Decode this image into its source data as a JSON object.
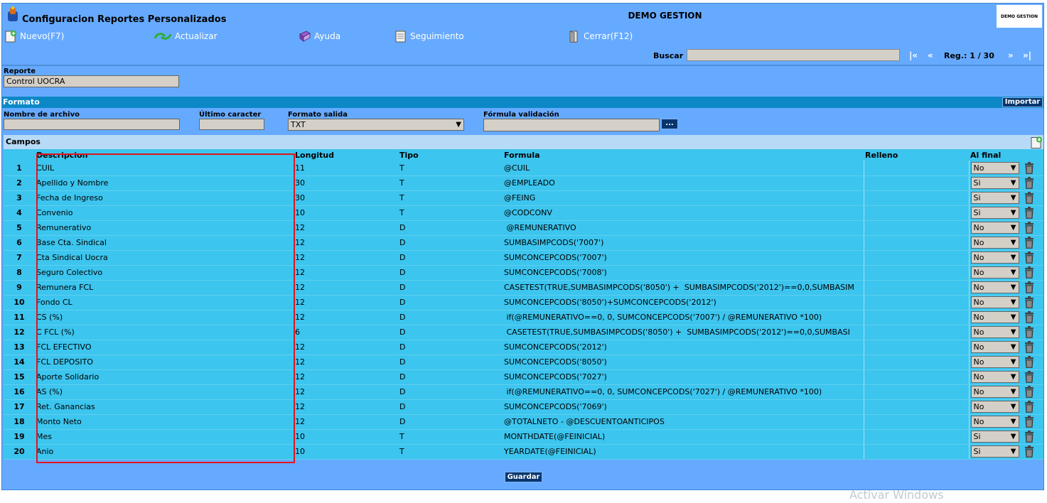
{
  "window": {
    "title": "Configuracion Reportes Personalizados",
    "company": "DEMO GESTION",
    "logo_text": "DEMO GESTION"
  },
  "toolbar": {
    "nuevo": "Nuevo(F7)",
    "actualizar": "Actualizar",
    "ayuda": "Ayuda",
    "seguimiento": "Seguimiento",
    "cerrar": "Cerrar(F12)"
  },
  "search": {
    "label": "Buscar",
    "value": "",
    "first": "|«",
    "prev": "«",
    "next": "»",
    "last": "»|",
    "record": "Reg.: 1 / 30"
  },
  "reporte": {
    "label": "Reporte",
    "value": "Control UOCRA"
  },
  "formato": {
    "section_title": "Formato",
    "importar": "Importar",
    "nombre_label": "Nombre de archivo",
    "nombre_value": "",
    "ultimo_label": "Último caracter",
    "ultimo_value": "",
    "salida_label": "Formato salida",
    "salida_value": "TXT",
    "formula_label": "Fórmula validación",
    "formula_value": "",
    "formula_button": "..."
  },
  "campos": {
    "title": "Campos",
    "headers": {
      "descripcion": "Descripcion",
      "longitud": "Longitud",
      "tipo": "Tipo",
      "formula": "Formula",
      "relleno": "Relleno",
      "al_final": "Al final"
    },
    "rows": [
      {
        "n": "1",
        "desc": "CUIL",
        "len": "11",
        "tipo": "T",
        "formula": "@CUIL",
        "relleno": "",
        "al_final": "No"
      },
      {
        "n": "2",
        "desc": "Apellido y Nombre",
        "len": "30",
        "tipo": "T",
        "formula": "@EMPLEADO",
        "relleno": "",
        "al_final": "Si"
      },
      {
        "n": "3",
        "desc": "Fecha de Ingreso",
        "len": "30",
        "tipo": "T",
        "formula": "@FEING",
        "relleno": "",
        "al_final": "Si"
      },
      {
        "n": "4",
        "desc": "Convenio",
        "len": "10",
        "tipo": "T",
        "formula": "@CODCONV",
        "relleno": "",
        "al_final": "Si"
      },
      {
        "n": "5",
        "desc": "Remunerativo",
        "len": "12",
        "tipo": "D",
        "formula": " @REMUNERATIVO",
        "relleno": "",
        "al_final": "No"
      },
      {
        "n": "6",
        "desc": "Base Cta. Sindical",
        "len": "12",
        "tipo": "D",
        "formula": "SUMBASIMPCODS('7007')",
        "relleno": "",
        "al_final": "No"
      },
      {
        "n": "7",
        "desc": "Cta Sindical Uocra",
        "len": "12",
        "tipo": "D",
        "formula": "SUMCONCEPCODS('7007')",
        "relleno": "",
        "al_final": "No"
      },
      {
        "n": "8",
        "desc": "Seguro Colectivo",
        "len": "12",
        "tipo": "D",
        "formula": "SUMCONCEPCODS('7008')",
        "relleno": "",
        "al_final": "No"
      },
      {
        "n": "9",
        "desc": "Remunera FCL",
        "len": "12",
        "tipo": "D",
        "formula": "CASETEST(TRUE,SUMBASIMPCODS('8050') +  SUMBASIMPCODS('2012')==0,0,SUMBASIM",
        "relleno": "",
        "al_final": "No"
      },
      {
        "n": "10",
        "desc": "Fondo CL",
        "len": "12",
        "tipo": "D",
        "formula": "SUMCONCEPCODS('8050')+SUMCONCEPCODS('2012')",
        "relleno": "",
        "al_final": "No"
      },
      {
        "n": "11",
        "desc": "CS (%)",
        "len": "12",
        "tipo": "D",
        "formula": " if(@REMUNERATIVO==0, 0, SUMCONCEPCODS('7007') / @REMUNERATIVO *100)",
        "relleno": "",
        "al_final": "No"
      },
      {
        "n": "12",
        "desc": "C FCL (%)",
        "len": "6",
        "tipo": "D",
        "formula": " CASETEST(TRUE,SUMBASIMPCODS('8050') +  SUMBASIMPCODS('2012')==0,0,SUMBASI",
        "relleno": "",
        "al_final": "No"
      },
      {
        "n": "13",
        "desc": "FCL EFECTIVO",
        "len": "12",
        "tipo": "D",
        "formula": "SUMCONCEPCODS('2012')",
        "relleno": "",
        "al_final": "No"
      },
      {
        "n": "14",
        "desc": "FCL DEPOSITO",
        "len": "12",
        "tipo": "D",
        "formula": "SUMCONCEPCODS('8050')",
        "relleno": "",
        "al_final": "No"
      },
      {
        "n": "15",
        "desc": "Aporte Solidario",
        "len": "12",
        "tipo": "D",
        "formula": "SUMCONCEPCODS('7027')",
        "relleno": "",
        "al_final": "No"
      },
      {
        "n": "16",
        "desc": "AS (%)",
        "len": "12",
        "tipo": "D",
        "formula": " if(@REMUNERATIVO==0, 0, SUMCONCEPCODS('7027') / @REMUNERATIVO *100)",
        "relleno": "",
        "al_final": "No"
      },
      {
        "n": "17",
        "desc": "Ret. Ganancias",
        "len": "12",
        "tipo": "D",
        "formula": "SUMCONCEPCODS('7069')",
        "relleno": "",
        "al_final": "No"
      },
      {
        "n": "18",
        "desc": "Monto Neto",
        "len": "12",
        "tipo": "D",
        "formula": "@TOTALNETO - @DESCUENTOANTICIPOS",
        "relleno": "",
        "al_final": "No"
      },
      {
        "n": "19",
        "desc": "Mes",
        "len": "10",
        "tipo": "T",
        "formula": "MONTHDATE(@FEINICIAL)",
        "relleno": "",
        "al_final": "Si"
      },
      {
        "n": "20",
        "desc": "Anio",
        "len": "10",
        "tipo": "T",
        "formula": "YEARDATE(@FEINICIAL)",
        "relleno": "",
        "al_final": "Si"
      }
    ]
  },
  "footer": {
    "guardar": "Guardar",
    "watermark": "Activar Windows"
  },
  "colors": {
    "background": "#66aaff",
    "section": "#0c88c6",
    "grid": "#3cc5ee",
    "highlight": "#e0141e"
  }
}
